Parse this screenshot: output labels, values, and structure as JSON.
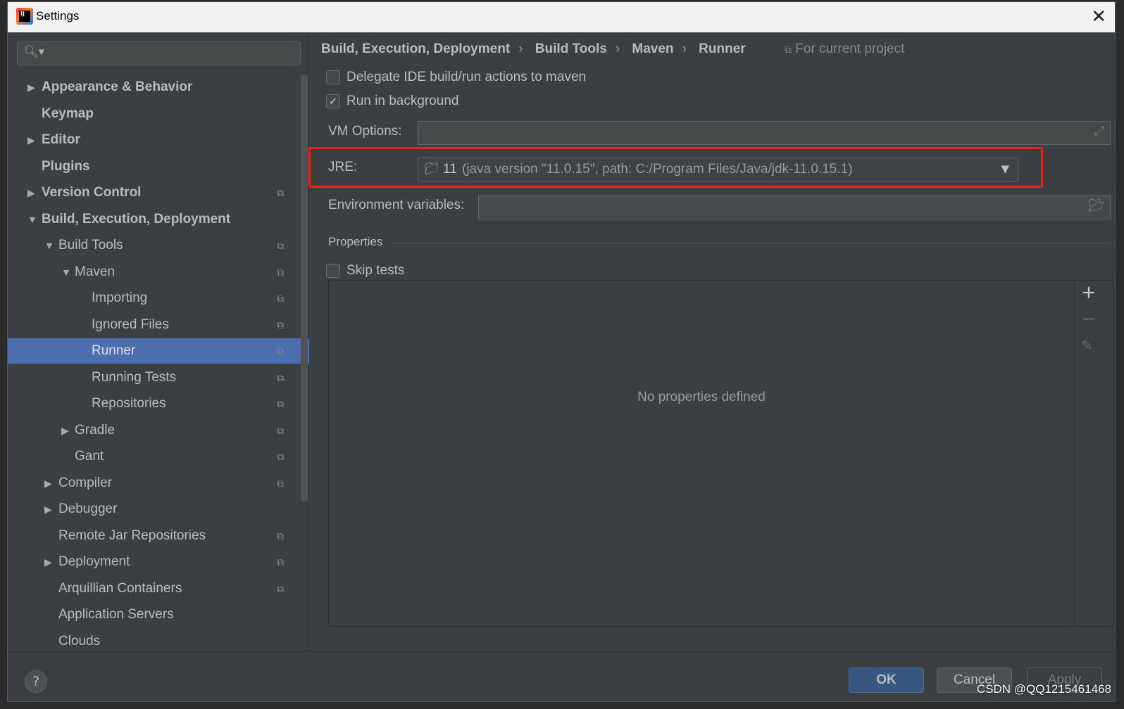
{
  "window": {
    "title": "Settings",
    "close_icon": "close-icon",
    "logo": "IJ"
  },
  "sidebar": {
    "search_placeholder": "",
    "items": [
      {
        "label": "Appearance & Behavior",
        "level": 0,
        "arrow": "right",
        "bold": true,
        "copy": false
      },
      {
        "label": "Keymap",
        "level": 0,
        "arrow": "",
        "bold": true,
        "copy": false
      },
      {
        "label": "Editor",
        "level": 0,
        "arrow": "right",
        "bold": true,
        "copy": false
      },
      {
        "label": "Plugins",
        "level": 0,
        "arrow": "",
        "bold": true,
        "copy": false
      },
      {
        "label": "Version Control",
        "level": 0,
        "arrow": "right",
        "bold": true,
        "copy": true
      },
      {
        "label": "Build, Execution, Deployment",
        "level": 0,
        "arrow": "down",
        "bold": true,
        "copy": false
      },
      {
        "label": "Build Tools",
        "level": 1,
        "arrow": "down",
        "bold": false,
        "copy": true
      },
      {
        "label": "Maven",
        "level": 2,
        "arrow": "down",
        "bold": false,
        "copy": true
      },
      {
        "label": "Importing",
        "level": 3,
        "arrow": "",
        "bold": false,
        "copy": true
      },
      {
        "label": "Ignored Files",
        "level": 3,
        "arrow": "",
        "bold": false,
        "copy": true
      },
      {
        "label": "Runner",
        "level": 3,
        "arrow": "",
        "bold": false,
        "copy": true,
        "selected": true
      },
      {
        "label": "Running Tests",
        "level": 3,
        "arrow": "",
        "bold": false,
        "copy": true
      },
      {
        "label": "Repositories",
        "level": 3,
        "arrow": "",
        "bold": false,
        "copy": true
      },
      {
        "label": "Gradle",
        "level": 2,
        "arrow": "right",
        "bold": false,
        "copy": true
      },
      {
        "label": "Gant",
        "level": 2,
        "arrow": "",
        "bold": false,
        "copy": true
      },
      {
        "label": "Compiler",
        "level": 1,
        "arrow": "right",
        "bold": false,
        "copy": true
      },
      {
        "label": "Debugger",
        "level": 1,
        "arrow": "right",
        "bold": false,
        "copy": false
      },
      {
        "label": "Remote Jar Repositories",
        "level": 1,
        "arrow": "",
        "bold": false,
        "copy": true
      },
      {
        "label": "Deployment",
        "level": 1,
        "arrow": "right",
        "bold": false,
        "copy": true
      },
      {
        "label": "Arquillian Containers",
        "level": 1,
        "arrow": "",
        "bold": false,
        "copy": true
      },
      {
        "label": "Application Servers",
        "level": 1,
        "arrow": "",
        "bold": false,
        "copy": false
      },
      {
        "label": "Clouds",
        "level": 1,
        "arrow": "",
        "bold": false,
        "copy": false
      }
    ]
  },
  "breadcrumb": {
    "items": [
      "Build, Execution, Deployment",
      "Build Tools",
      "Maven",
      "Runner"
    ],
    "scope": "For current project"
  },
  "form": {
    "delegate": {
      "label": "Delegate IDE build/run actions to maven",
      "checked": false
    },
    "background": {
      "label": "Run in background",
      "checked": true
    },
    "vm_options": {
      "label": "VM Options:",
      "value": ""
    },
    "jre": {
      "label": "JRE:",
      "value_main": "11",
      "value_detail": "(java version \"11.0.15\", path: C:/Program Files/Java/jdk-11.0.15.1)"
    },
    "env": {
      "label": "Environment variables:",
      "value": ""
    },
    "properties_title": "Properties",
    "skip_tests": {
      "label": "Skip tests",
      "checked": false
    },
    "empty_text": "No properties defined"
  },
  "buttons": {
    "ok": "OK",
    "cancel": "Cancel",
    "apply": "Apply",
    "help": "?"
  },
  "watermark": "CSDN @QQ1215461468",
  "colors": {
    "selection": "#4b6eaf",
    "highlight": "#f01d1d",
    "ok": "#365880"
  }
}
